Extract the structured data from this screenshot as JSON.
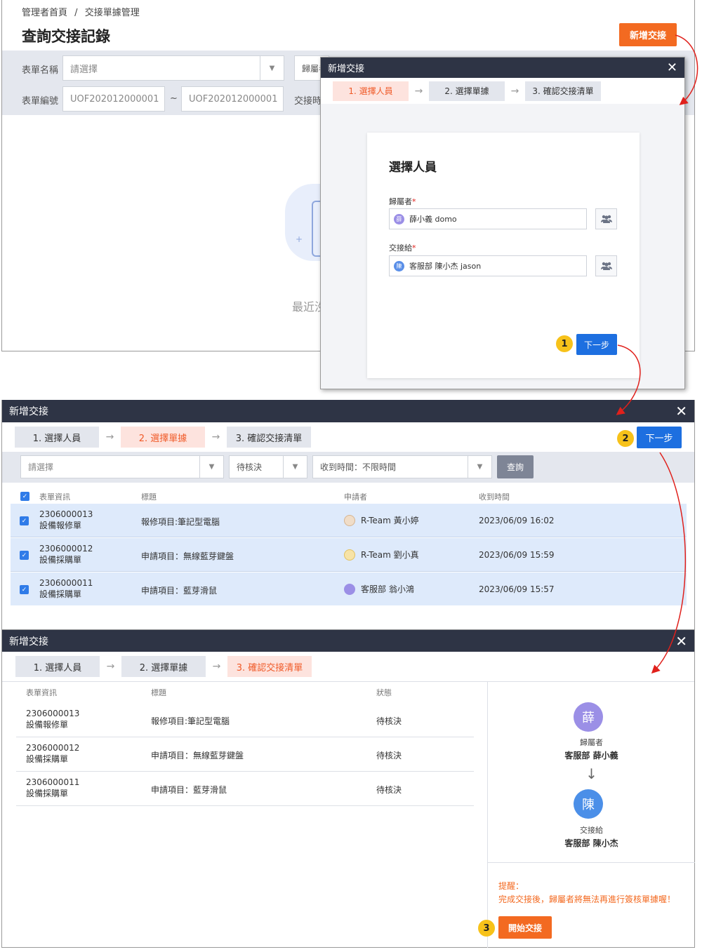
{
  "breadcrumb": {
    "home": "管理者首頁",
    "sep": "/",
    "current": "交接單據管理"
  },
  "page_title": "查詢交接記錄",
  "new_handover_button": "新增交接",
  "filters": {
    "form_name_label": "表單名稱",
    "form_name_placeholder": "請選擇",
    "owner_label_partial": "歸屬者",
    "form_no_label": "表單編號",
    "form_no_from": "UOF202012000001",
    "tilde": "~",
    "form_no_to": "UOF202012000001",
    "handover_time_label_partial": "交接時"
  },
  "empty_state_text_partial": "最近沒",
  "modal1": {
    "title": "新增交接",
    "steps": [
      "1. 選擇人員",
      "2. 選擇單據",
      "3. 確認交接清單"
    ],
    "card_title": "選擇人員",
    "owner_label": "歸屬者",
    "owner_avatar": "薛",
    "owner_value": "薛小義 domo",
    "handover_to_label": "交接給",
    "handover_avatar": "陳",
    "handover_value": "客服部 陳小杰 jason",
    "required_mark": "*",
    "next_button": "下一步",
    "badge": "1"
  },
  "modal2": {
    "title": "新增交接",
    "steps": [
      "1. 選擇人員",
      "2. 選擇單據",
      "3. 確認交接清單"
    ],
    "next_button": "下一步",
    "badge": "2",
    "filter_select_placeholder": "請選擇",
    "status_select": "待核決",
    "time_select": "收到時間：不限時間",
    "query_button": "查詢",
    "headers": {
      "info": "表單資訊",
      "title": "標題",
      "applicant": "申請者",
      "received": "收到時間"
    },
    "rows": [
      {
        "no": "2306000013",
        "type": "設備報修單",
        "title": "報修項目:筆記型電腦",
        "applicant": "R-Team 黃小婷",
        "time": "2023/06/09 16:02"
      },
      {
        "no": "2306000012",
        "type": "設備採購單",
        "title": "申請項目：無線藍芽鍵盤",
        "applicant": "R-Team 劉小真",
        "time": "2023/06/09 15:59"
      },
      {
        "no": "2306000011",
        "type": "設備採購單",
        "title": "申請項目：藍芽滑鼠",
        "applicant": "客服部 翁小鴻",
        "time": "2023/06/09 15:57"
      }
    ]
  },
  "modal3": {
    "title": "新增交接",
    "steps": [
      "1. 選擇人員",
      "2. 選擇單據",
      "3. 確認交接清單"
    ],
    "headers": {
      "info": "表單資訊",
      "title": "標題",
      "status": "狀態"
    },
    "rows": [
      {
        "no": "2306000013",
        "type": "設備報修單",
        "title": "報修項目:筆記型電腦",
        "status": "待核決"
      },
      {
        "no": "2306000012",
        "type": "設備採購單",
        "title": "申請項目：無線藍芽鍵盤",
        "status": "待核決"
      },
      {
        "no": "2306000011",
        "type": "設備採購單",
        "title": "申請項目：藍芽滑鼠",
        "status": "待核決"
      }
    ],
    "owner_avatar": "薛",
    "owner_label": "歸屬者",
    "owner_name": "客服部 薛小義",
    "down_arrow": "↓",
    "to_avatar": "陳",
    "to_label": "交接給",
    "to_name": "客服部 陳小杰",
    "reminder_title": "提醒：",
    "reminder_text": "完成交接後，歸屬者將無法再進行簽核單據喔！",
    "start_button": "開始交接",
    "badge": "3"
  },
  "colors": {
    "accent": "#f36a21",
    "primary": "#1d6fe0",
    "header": "#2e3445",
    "annotation": "#e0201b"
  }
}
